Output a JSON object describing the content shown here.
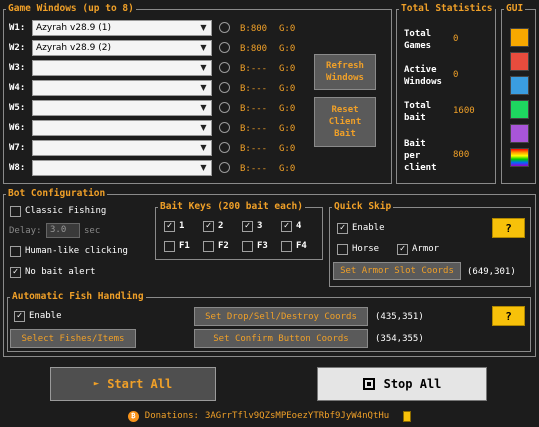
{
  "game_windows": {
    "title": "Game Windows (up to 8)",
    "rows": [
      {
        "label": "W1:",
        "value": "Azyrah v28.9 (1)",
        "bait": "B:800",
        "gold": "G:0"
      },
      {
        "label": "W2:",
        "value": "Azyrah v28.9 (2)",
        "bait": "B:800",
        "gold": "G:0"
      },
      {
        "label": "W3:",
        "value": "",
        "bait": "B:---",
        "gold": "G:0"
      },
      {
        "label": "W4:",
        "value": "",
        "bait": "B:---",
        "gold": "G:0"
      },
      {
        "label": "W5:",
        "value": "",
        "bait": "B:---",
        "gold": "G:0"
      },
      {
        "label": "W6:",
        "value": "",
        "bait": "B:---",
        "gold": "G:0"
      },
      {
        "label": "W7:",
        "value": "",
        "bait": "B:---",
        "gold": "G:0"
      },
      {
        "label": "W8:",
        "value": "",
        "bait": "B:---",
        "gold": "G:0"
      }
    ],
    "refresh_label": "Refresh\nWindows",
    "reset_label": "Reset\nClient\nBait"
  },
  "total_statistics": {
    "title": "Total Statistics",
    "total_games_label": "Total\nGames",
    "total_games_value": "0",
    "active_windows_label": "Active\nWindows",
    "active_windows_value": "0",
    "total_bait_label": "Total\nbait",
    "total_bait_value": "1600",
    "bait_per_client_label": "Bait\nper\nclient",
    "bait_per_client_value": "800"
  },
  "gui": {
    "title": "GUI",
    "swatches": [
      "#f7a800",
      "#e84c3d",
      "#3a9de0",
      "#1ed760",
      "#a855d8",
      "rainbow"
    ]
  },
  "bot_config": {
    "title": "Bot Configuration",
    "classic_fishing_label": "Classic Fishing",
    "classic_fishing_checked": false,
    "delay_label": "Delay:",
    "delay_value": "3.0",
    "delay_unit": "sec",
    "humanlike_label": "Human-like clicking",
    "humanlike_checked": false,
    "no_bait_alert_label": "No bait alert",
    "no_bait_alert_checked": true
  },
  "bait_keys": {
    "title": "Bait Keys (200 bait each)",
    "keys": [
      {
        "label": "1",
        "checked": true
      },
      {
        "label": "2",
        "checked": true
      },
      {
        "label": "3",
        "checked": true
      },
      {
        "label": "4",
        "checked": true
      },
      {
        "label": "F1",
        "checked": false
      },
      {
        "label": "F2",
        "checked": false
      },
      {
        "label": "F3",
        "checked": false
      },
      {
        "label": "F4",
        "checked": false
      }
    ]
  },
  "quick_skip": {
    "title": "Quick Skip",
    "enable_label": "Enable",
    "enable_checked": true,
    "horse_label": "Horse",
    "horse_checked": false,
    "armor_label": "Armor",
    "armor_checked": true,
    "set_armor_label": "Set Armor Slot Coords",
    "armor_coords": "(649,301)",
    "help_label": "?"
  },
  "auto_fish": {
    "title": "Automatic Fish Handling",
    "enable_label": "Enable",
    "enable_checked": true,
    "select_label": "Select Fishes/Items",
    "set_drop_label": "Set Drop/Sell/Destroy Coords",
    "drop_coords": "(435,351)",
    "set_confirm_label": "Set Confirm Button Coords",
    "confirm_coords": "(354,355)",
    "help_label": "?"
  },
  "actions": {
    "start_icon": "►",
    "start_label": "Start All",
    "stop_label": "Stop All"
  },
  "footer": {
    "donations_label": "Donations:",
    "address": "3AGrrTflv9QZsMPEoezYTRbf9JyW4nQtHu"
  }
}
